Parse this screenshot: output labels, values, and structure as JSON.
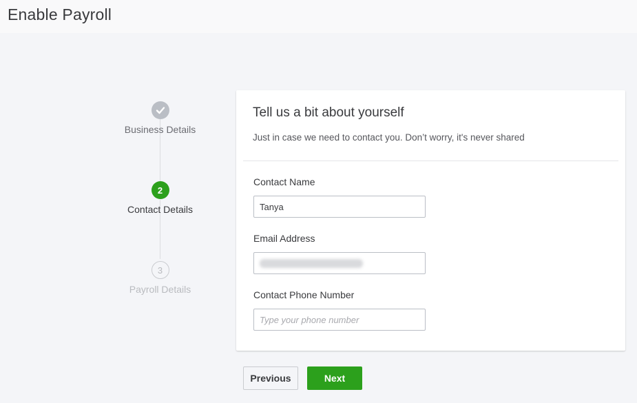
{
  "page": {
    "title": "Enable Payroll"
  },
  "stepper": {
    "steps": [
      {
        "number": "✓",
        "label": "Business Details",
        "state": "done"
      },
      {
        "number": "2",
        "label": "Contact Details",
        "state": "active"
      },
      {
        "number": "3",
        "label": "Payroll Details",
        "state": "todo"
      }
    ]
  },
  "form": {
    "title": "Tell us a bit about yourself",
    "subtitle": "Just in case we need to contact you. Don’t worry, it's never shared",
    "contact_name": {
      "label": "Contact Name",
      "value": "Tanya"
    },
    "email": {
      "label": "Email Address"
    },
    "phone": {
      "label": "Contact Phone Number",
      "placeholder": "Type your phone number"
    }
  },
  "buttons": {
    "previous": "Previous",
    "next": "Next"
  },
  "colors": {
    "accent": "#2ca01c",
    "done_step": "#babec5",
    "background": "#f4f5f8"
  }
}
